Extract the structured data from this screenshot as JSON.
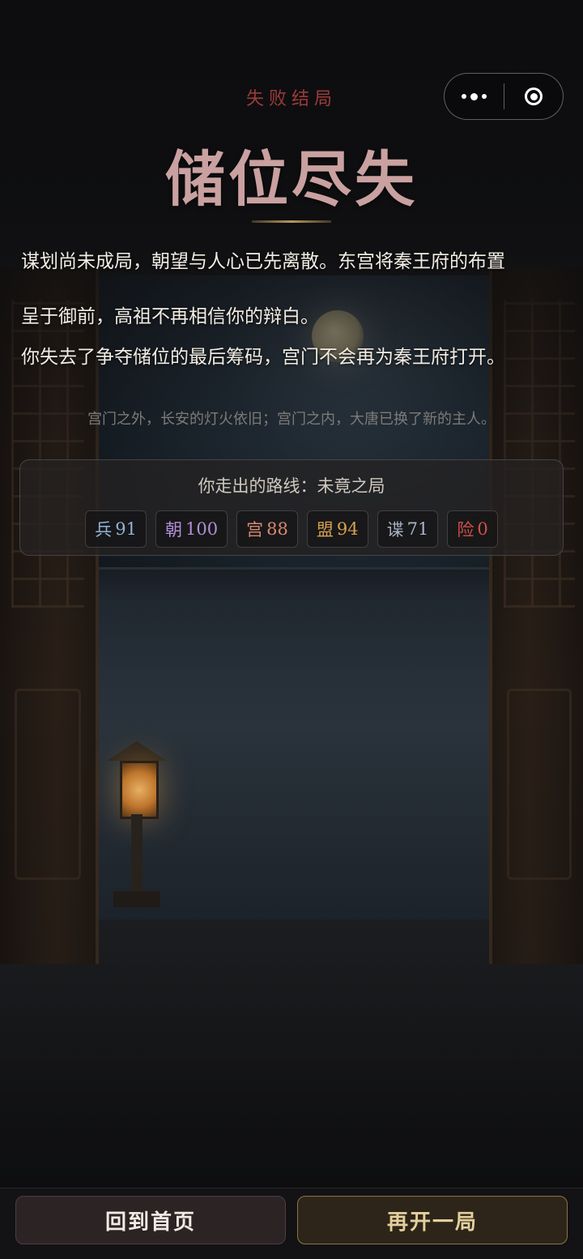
{
  "header": {
    "subtitle": "失败结局",
    "title": "储位尽失"
  },
  "narrative": {
    "line1": "谋划尚未成局，朝望与人心已先离散。东宫将秦王府的布置",
    "line2": "呈于御前，高祖不再相信你的辩白。",
    "line3": "你失去了争夺储位的最后筹码，宫门不会再为秦王府打开。"
  },
  "note": "宫门之外，长安的灯火依旧；宫门之内，大唐已换了新的主人。",
  "route": {
    "label": "你走出的路线：未竟之局",
    "stats": [
      {
        "label": "兵",
        "value": "91",
        "color": "#8fb4d8"
      },
      {
        "label": "朝",
        "value": "100",
        "color": "#b28ed6"
      },
      {
        "label": "宫",
        "value": "88",
        "color": "#d68a6e"
      },
      {
        "label": "盟",
        "value": "94",
        "color": "#d6a24e"
      },
      {
        "label": "谍",
        "value": "71",
        "color": "#a8b6c8"
      },
      {
        "label": "险",
        "value": "0",
        "color": "#d0504a"
      }
    ]
  },
  "buttons": {
    "home": "回到首页",
    "restart": "再开一局"
  },
  "capsule": {
    "more_icon": "more-dots-icon",
    "close_icon": "close-circle-icon"
  }
}
